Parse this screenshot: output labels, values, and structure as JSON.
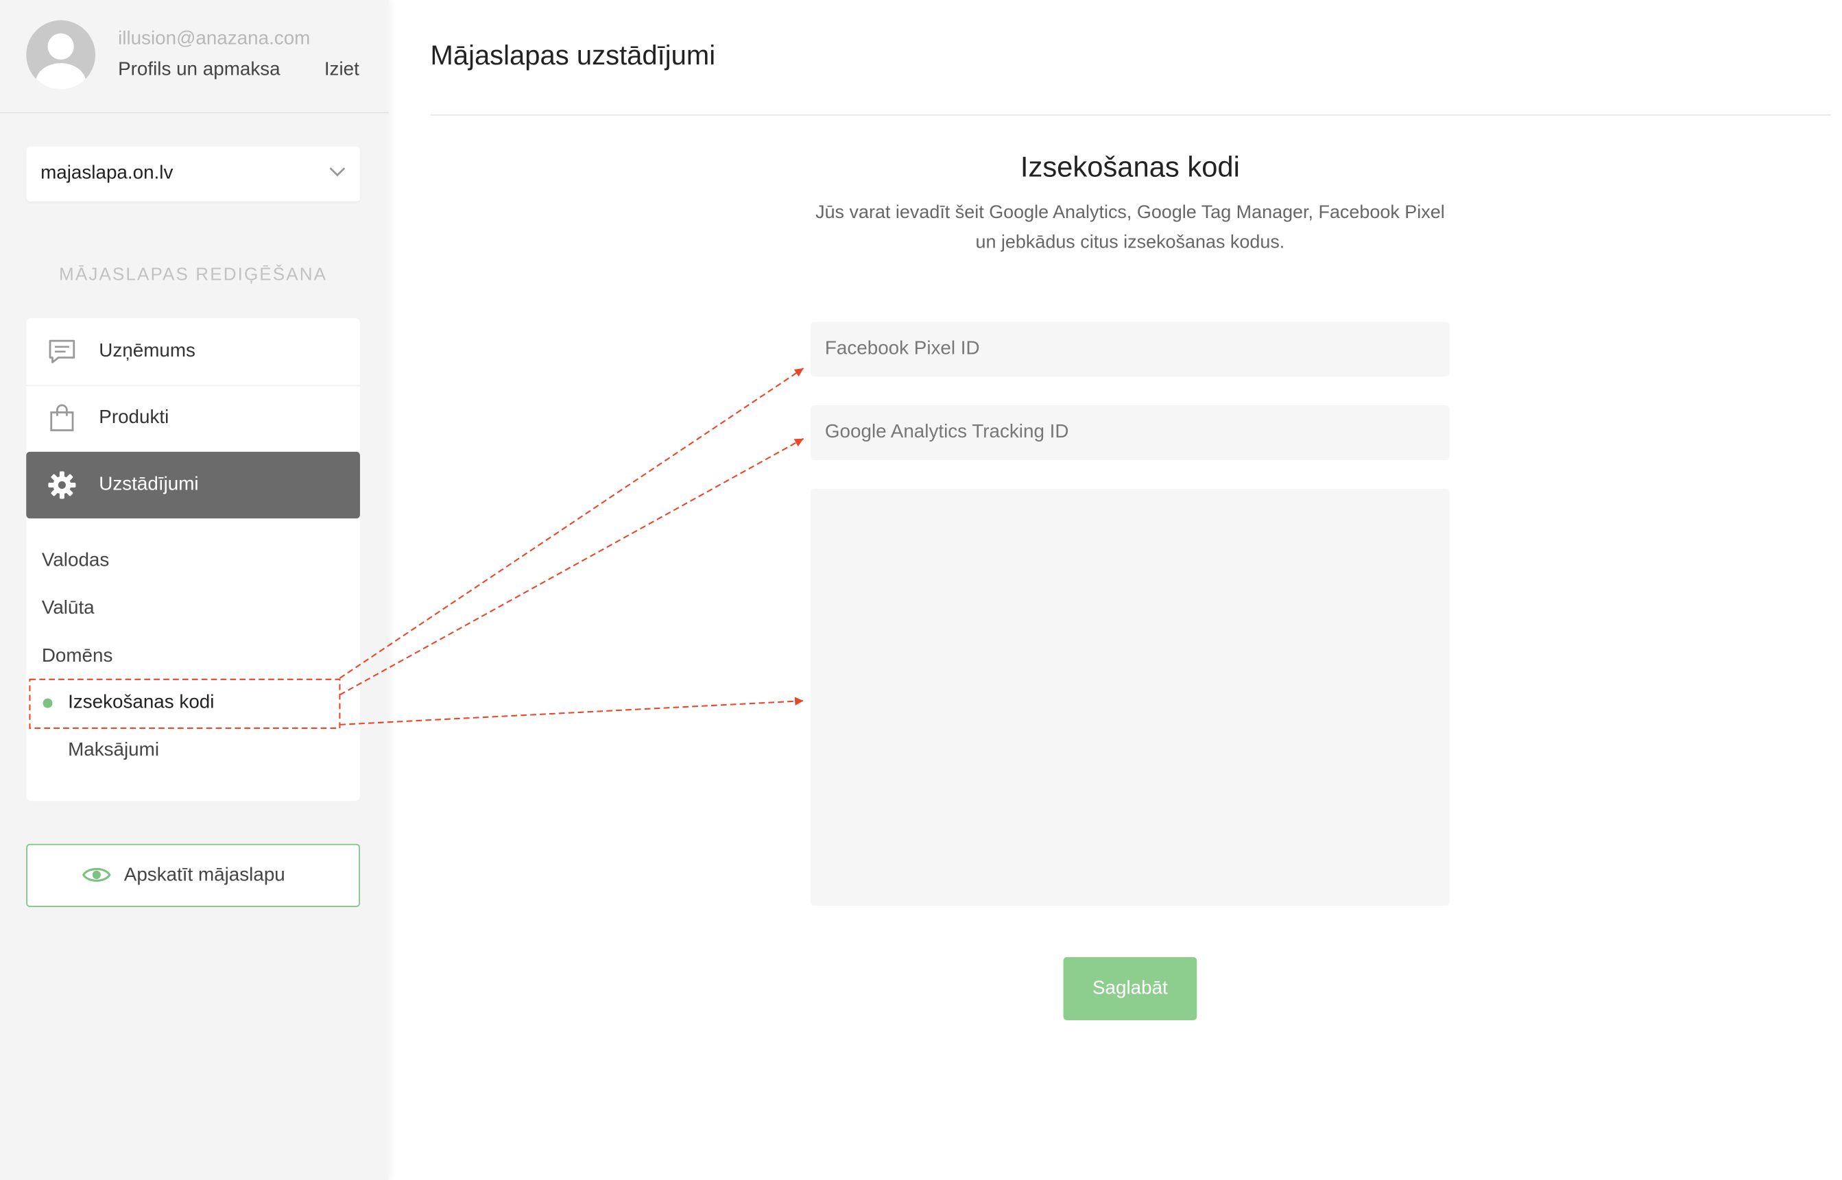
{
  "user": {
    "email": "illusion@anazana.com",
    "profile_link": "Profils un apmaksa",
    "logout_link": "Iziet"
  },
  "site_selector": {
    "selected": "majaslapa.on.lv"
  },
  "sidebar": {
    "section_title": "MĀJASLAPAS REDIĢĒŠANA",
    "menu": [
      {
        "label": "Uzņēmums",
        "icon": "chat-icon"
      },
      {
        "label": "Produkti",
        "icon": "shopping-bag-icon"
      },
      {
        "label": "Uzstādījumi",
        "icon": "gear-icon",
        "active": true
      }
    ],
    "submenu": [
      {
        "label": "Valodas"
      },
      {
        "label": "Valūta"
      },
      {
        "label": "Domēns"
      },
      {
        "label": "Izsekošanas kodi",
        "current": true
      },
      {
        "label": "Maksājumi"
      }
    ],
    "view_button": "Apskatīt mājaslapu"
  },
  "main": {
    "page_title": "Mājaslapas uzstādījumi",
    "panel_title": "Izsekošanas kodi",
    "panel_description": "Jūs varat ievadīt šeit Google Analytics, Google Tag Manager, Facebook Pixel un jebkādus citus izsekošanas kodus.",
    "facebook_placeholder": "Facebook Pixel ID",
    "ga_placeholder": "Google Analytics Tracking ID",
    "codes_placeholder": "",
    "save_label": "Saglabāt"
  },
  "colors": {
    "accent_green": "#7cc283",
    "save_button": "#8dcd8d",
    "active_menu": "#6b6b6b",
    "annotation": "#e8472a"
  }
}
